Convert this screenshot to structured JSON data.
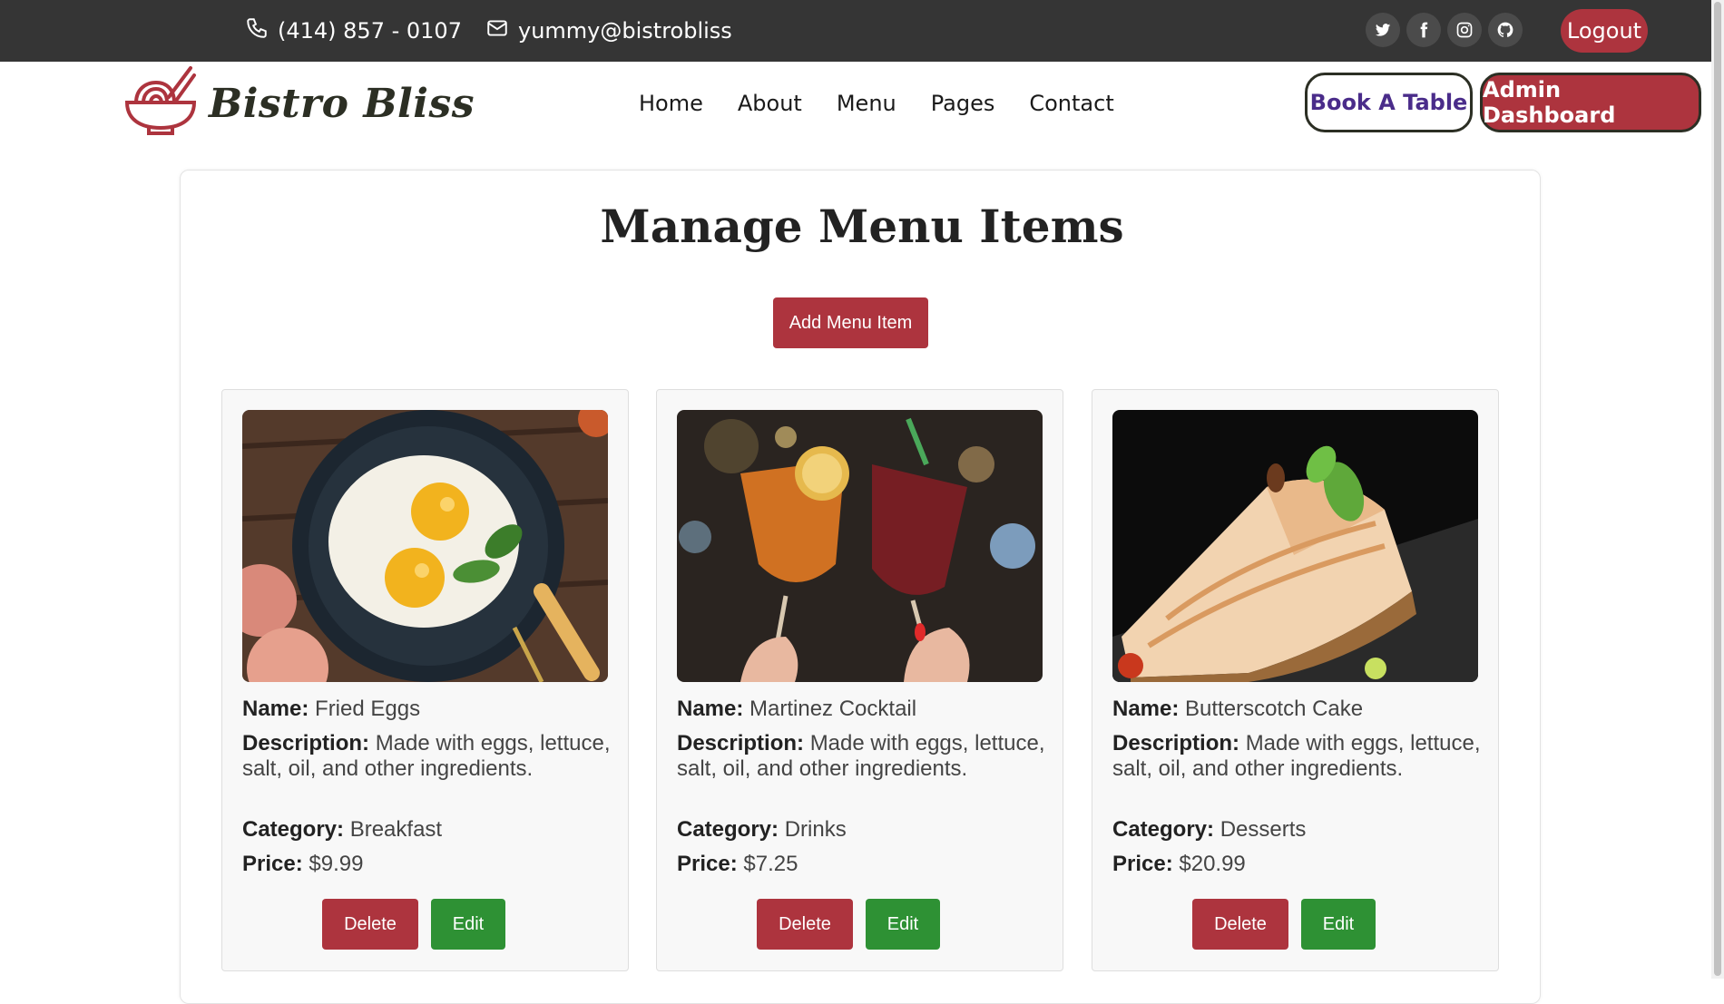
{
  "topbar": {
    "phone": "(414) 857 - 0107",
    "email": "yummy@bistrobliss",
    "socials": [
      "twitter-icon",
      "facebook-icon",
      "instagram-icon",
      "github-icon"
    ],
    "logout_label": "Logout"
  },
  "navbar": {
    "brand": "Bistro Bliss",
    "links": [
      "Home",
      "About",
      "Menu",
      "Pages",
      "Contact"
    ],
    "book_label": "Book A Table",
    "admin_label": "Admin Dashboard"
  },
  "main": {
    "title": "Manage Menu Items",
    "add_label": "Add Menu Item",
    "field_labels": {
      "name": "Name:",
      "description": "Description:",
      "category": "Category:",
      "price": "Price:"
    },
    "items": [
      {
        "name": "Fried Eggs",
        "description": "Made with eggs, lettuce, salt, oil, and other ingredients.",
        "category": "Breakfast",
        "price": "$9.99",
        "delete_label": "Delete",
        "edit_label": "Edit"
      },
      {
        "name": "Martinez Cocktail",
        "description": "Made with eggs, lettuce, salt, oil, and other ingredients.",
        "category": "Drinks",
        "price": "$7.25",
        "delete_label": "Delete",
        "edit_label": "Edit"
      },
      {
        "name": "Butterscotch Cake",
        "description": "Made with eggs, lettuce, salt, oil, and other ingredients.",
        "category": "Desserts",
        "price": "$20.99",
        "delete_label": "Delete",
        "edit_label": "Edit"
      }
    ]
  },
  "colors": {
    "topbar_bg": "#353535",
    "accent_red": "#ad343e",
    "edit_green": "#2e9134",
    "book_text": "#4a2c8a"
  }
}
